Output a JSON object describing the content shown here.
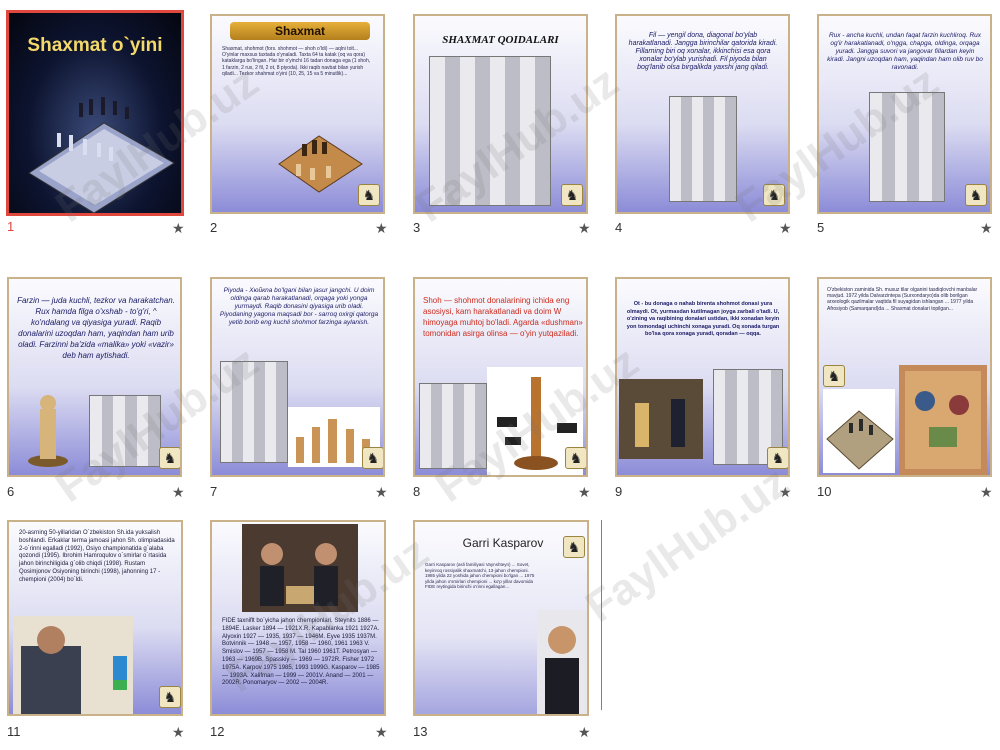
{
  "watermark": "FaylHub.uz",
  "selected_slide": 1,
  "slides": [
    {
      "number": "1",
      "title": "Shaxmat o`yini"
    },
    {
      "number": "2",
      "title": "Shaxmat",
      "text": "Shaxmat, shohmot (fors. shohmot — shoh o'ldi) — aqlni tolt... O'yinlar maxsus taxtada o'ynaladi. Taxta 64 ta katak (oq va qora) kataklarga bo'lingan. Har bir o'yinchi 16 tadan donaga ega (1 shoh, 1 farzin, 2 rux, 2 fil, 2 ot, 8 piyoda). Ikki raqib navbat bilan yurish qiladi... Tezkor shahmat o'yini (10, 25, 15 va 5 minutlik)..."
    },
    {
      "number": "3",
      "title": "SHAXMAT QOIDALARI"
    },
    {
      "number": "4",
      "text": "Fil — yengil dona, diagonal bo'ylab harakatlanadi. Jangga birinchilar qatorida kiradi. Fillarning biri oq xonalar, ikkinchisi esa qora xonalar bo'ylab yurishadi. Fil piyoda bilan bog'lanib olsa birgalikda yaxshi jang qiladi."
    },
    {
      "number": "5",
      "text": "Rux - ancha kuchli, undan faqat farzin kuchliroq. Rux og'ir harakatlanadi, o'ngga, chapga, oldinga, orqaga yuradi. Jangga suvori va jangovar fillardan keyin kiradi. Jangni uzoqdan ham, yaqindan ham olib ruv bo ravonadi."
    },
    {
      "number": "6",
      "text": "Farzin — juda kuchli, tezkor va harakatchan. Rux hamda filga o'xshab - to'g'ri, ^ ko'ndalang va qiyasiga yuradi. Raqib donalarini uzoqdan ham, yaqindan ham urib oladi. Farzinni ba'zida «malika» yoki «vazir» deb ham aytishadi."
    },
    {
      "number": "7",
      "text": "Piyoda - Хюйкnа bo'lgani bilan jasur jangchi. U doim oldinga qarab harakatlanadi, orqaga yoki yonga yurmaydi. Raqib donasini qiyasiga urib oladi. Piyodaning yagona maqsadi bor - sarroq oxirgi qatorga yetib borib eng kuchli shohmot farzinga aylanish."
    },
    {
      "number": "8",
      "text": "Shoh — shohmot donalarining ichida eng asosiysi, kam harakatlanadi va doim W himoyaga muhtoj bo'ladi. Agarda «dushman» tomonidan asirga olinsa — o'yin yutqaziladi."
    },
    {
      "number": "9",
      "text": "Ot - bu donaga o nahab birenta shohmot donasi yura olmaydi. Ot, yurmasdan kutilmagan joyga zarbali o'tadi. U, o'zining va raqibining donalari ustidan, ikki xonadan keyin yon tomondagi uchinchi xonaga yuradi. Oq xonada turgan bo'lsa qora xonaga yuradi, qoradan — oqqa."
    },
    {
      "number": "10",
      "text": "O'zbekiston zaminida Sh. musuz tilar olganini tasdiqlovchi manbalar mavjud. 1972 yilda Dalvarzintepa (Surxondaryo)da olib borilgan arxeologik qazilmalar vaqtida fil suyagidan ishlangan ... 1977 yilda Afrosiyob (Samarqand)da ... Shaxmat donalari topilgan..."
    },
    {
      "number": "11",
      "text": "20-asrning 50-yillaridan O`zbekiston Sh.ida yuksalish boshlandi. Erkaklar terma jamoasi jahon Sh. olimpiadasida 2-o`rinni egalladi (1992), Osiyo championatida g`alaba qozondi (1995). Ibrohim Hamroqulov o`smirlar o`rtasida jahon birinchiligida g`olib chiqdi (1998). Rustam Qosimjonov Osiyoning birinchi (1998), jahonning 17 -chempioni (2004) bo`ldi."
    },
    {
      "number": "12",
      "text": "FIDE taxniflt bo`yicha jahon chempionlari. Steynits 1886 — 1894E. Lasker 1894 — 1921X.R. Kapablanka 1921 1927A. Alyoxin 1927 — 1935, 1937 — 1946M. Eyve 1935 1937M. Botvinnik — 1948 — 1957, 1958 — 1960, 1961 1963 V. Smislov — 1957 — 1958 M. Tal 1960 1961T. Petrosyan — 1963 — 1969B. Spasskiy — 1969 — 1972R. Fisher 1972 1975A. Karpov 1975 1985, 1993 1999G. Kasparov — 1985 — 1993A. Xalifman — 1999 — 2001V. Anand — 2001 — 2002R. Ponomaryov — 2002 — 2004R."
    },
    {
      "number": "13",
      "title": "Garri Kasparov",
      "text": "Garri Kasparov (asli familiyasi Vaynshteyn) ... Sovet, keyinroq rossiyalik shaxmatchi, 13-jahon chempioni. 1985 yilda 22 yoshida jahon chempioni bo'lgan ... 1975 yilda jahon o'smirlari chempioni ... ko'p yillar davomida FIDE reytingida birinchi o'rinni egallagan..."
    }
  ]
}
